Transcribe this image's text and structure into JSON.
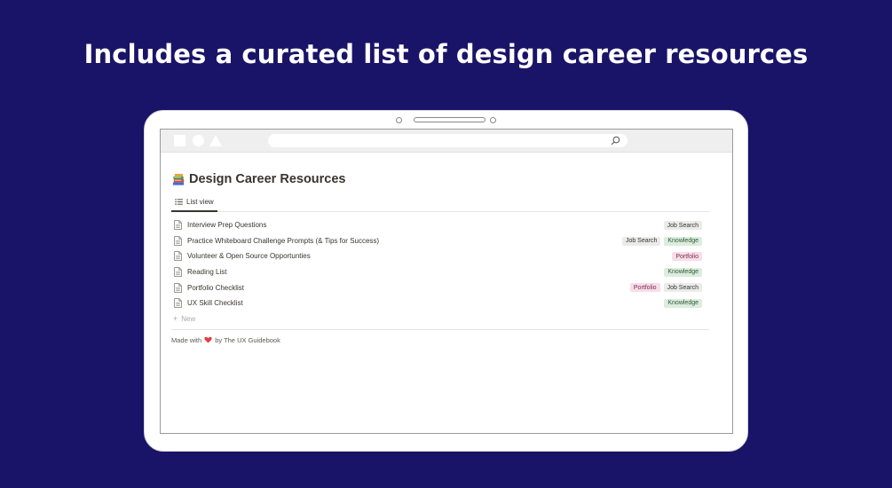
{
  "headline": "Includes a curated list of design career resources",
  "page": {
    "title": "Design Career Resources",
    "title_icon": "books-icon"
  },
  "tabs": [
    {
      "label": "List view",
      "icon": "list-icon"
    }
  ],
  "rows": [
    {
      "label": "Interview Prep Questions",
      "tags": [
        "Job Search"
      ]
    },
    {
      "label": "Practice Whiteboard Challenge Prompts (& Tips for Success)",
      "tags": [
        "Job Search",
        "Knowledge"
      ]
    },
    {
      "label": "Volunteer & Open Source Opportunties",
      "tags": [
        "Portfolio"
      ]
    },
    {
      "label": "Reading List",
      "tags": [
        "Knowledge"
      ]
    },
    {
      "label": "Portfolio Checklist",
      "tags": [
        "Portfolio",
        "Job Search"
      ]
    },
    {
      "label": "UX Skill Checklist",
      "tags": [
        "Knowledge"
      ]
    }
  ],
  "new_label": "New",
  "footer": {
    "before": "Made with",
    "after": "by The UX Guidebook"
  },
  "tag_colors": {
    "Job Search": {
      "bg": "#ebebea",
      "fg": "#37352f"
    },
    "Knowledge": {
      "bg": "#dcecdd",
      "fg": "#2d5a3a"
    },
    "Portfolio": {
      "bg": "#f7dde8",
      "fg": "#7a2e53"
    }
  },
  "colors": {
    "background": "#1a1468",
    "heart": "#e03e3e"
  }
}
